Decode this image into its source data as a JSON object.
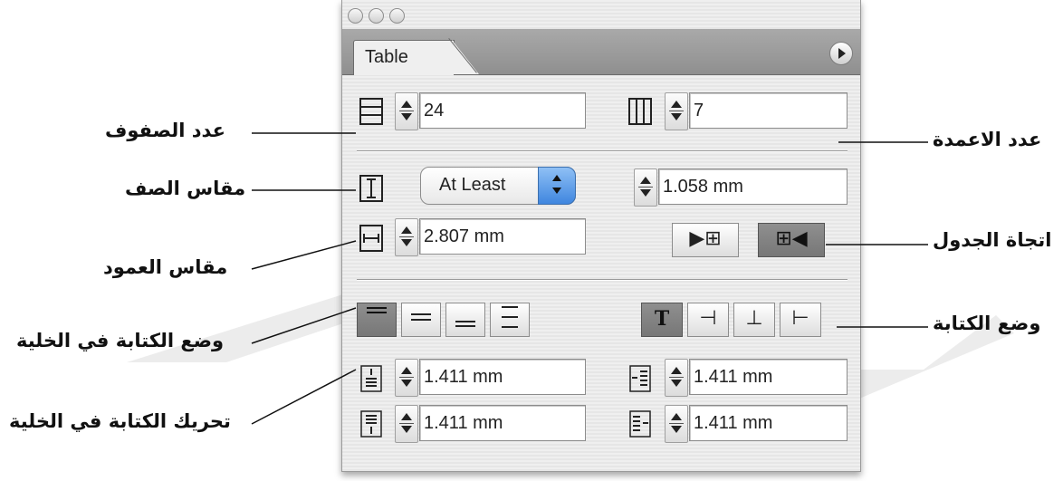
{
  "window": {
    "tab_label": "Table",
    "controls": [
      "close-button",
      "minimize-button",
      "zoom-button"
    ]
  },
  "table_panel": {
    "body_rows": "24",
    "columns": "7",
    "row_height_mode": "At Least",
    "row_height": "1.058 mm",
    "column_width": "2.807 mm",
    "inset_top": "1.411 mm",
    "inset_bottom": "1.411 mm",
    "inset_left": "1.411 mm",
    "inset_right": "1.411 mm",
    "direction_ltr_symbol": "▶⊞",
    "direction_rtl_symbol": "⊞◀",
    "align_buttons": [
      "≡",
      "≡",
      "≡",
      "☰"
    ],
    "rotate_buttons": [
      "T",
      "⊣",
      "⊥",
      "⊢"
    ]
  },
  "annotations": {
    "rows_count": "عدد الصفوف",
    "columns_count": "عدد الاعمدة",
    "row_height": "مقاس الصف",
    "column_width": "مقاس العمود",
    "table_direction": "اتجاة الجدول",
    "cell_text_mode": "وضع الكتابة في الخلية",
    "text_mode": "وضع الكتابة",
    "cell_text_move": "تحريك الكتابة في الخلية"
  },
  "colors": {
    "panel_bg": "#ececec",
    "tabstrip": "#9c9c9c",
    "accent_blue": "#3f86df",
    "watermark": "#e9e9e9"
  }
}
